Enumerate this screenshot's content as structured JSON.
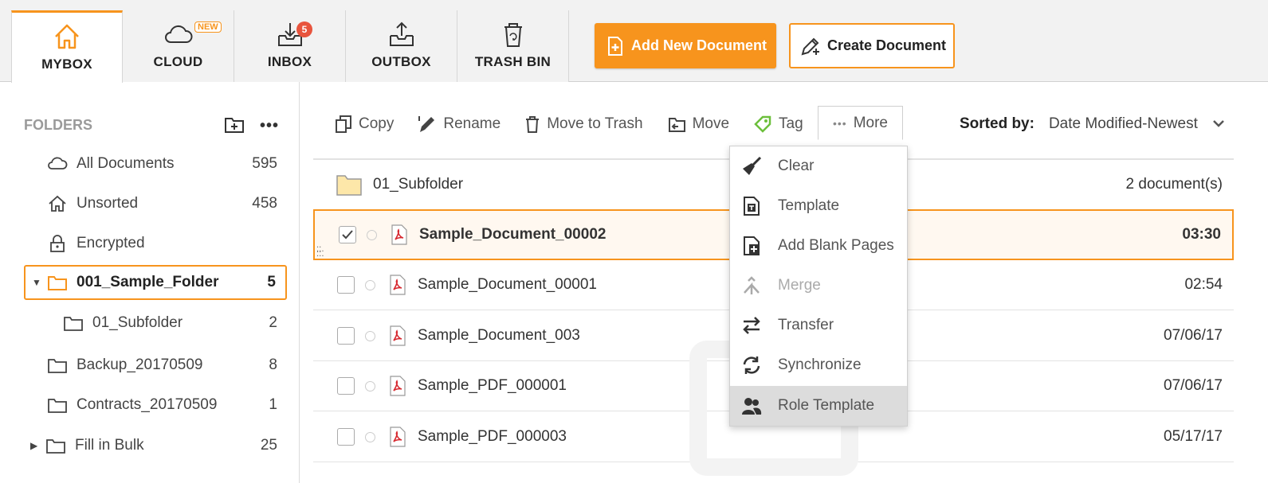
{
  "tabs": [
    {
      "label": "MYBOX",
      "icon": "home-icon"
    },
    {
      "label": "CLOUD",
      "icon": "cloud-icon",
      "badge": "NEW"
    },
    {
      "label": "INBOX",
      "icon": "inbox-icon",
      "badge": "5"
    },
    {
      "label": "OUTBOX",
      "icon": "outbox-icon"
    },
    {
      "label": "TRASH BIN",
      "icon": "trash-icon"
    }
  ],
  "header": {
    "add_new_label": "Add New Document",
    "create_label": "Create Document"
  },
  "sidebar": {
    "title": "FOLDERS",
    "more": "•••",
    "items": [
      {
        "label": "All Documents",
        "count": "595",
        "icon": "cloud-icon"
      },
      {
        "label": "Unsorted",
        "count": "458",
        "icon": "home-icon"
      },
      {
        "label": "Encrypted",
        "count": "",
        "icon": "lock-icon"
      },
      {
        "label": "001_Sample_Folder",
        "count": "5",
        "icon": "folder-icon",
        "expanded": "▼"
      },
      {
        "label": "01_Subfolder",
        "count": "2",
        "icon": "folder-icon"
      },
      {
        "label": "Backup_20170509",
        "count": "8",
        "icon": "folder-icon"
      },
      {
        "label": "Contracts_20170509",
        "count": "1",
        "icon": "folder-icon"
      },
      {
        "label": "Fill in Bulk",
        "count": "25",
        "icon": "folder-icon",
        "expanded": "▶"
      }
    ]
  },
  "toolbar": {
    "copy": "Copy",
    "rename": "Rename",
    "trash": "Move to Trash",
    "move": "Move",
    "tag": "Tag",
    "more": "More",
    "more_dots": "•••",
    "sorted_label": "Sorted by:",
    "sorted_value": "Date Modified-Newest"
  },
  "list": {
    "folder": {
      "name": "01_Subfolder",
      "info": "2 document(s)"
    },
    "rows": [
      {
        "name": "Sample_Document_00002",
        "date": "03:30"
      },
      {
        "name": "Sample_Document_00001",
        "date": "02:54"
      },
      {
        "name": "Sample_Document_003",
        "date": "07/06/17"
      },
      {
        "name": "Sample_PDF_000001",
        "date": "07/06/17"
      },
      {
        "name": "Sample_PDF_000003",
        "date": "05/17/17"
      }
    ]
  },
  "menu": {
    "items": [
      {
        "label": "Clear",
        "icon": "broom-icon"
      },
      {
        "label": "Template",
        "icon": "template-icon"
      },
      {
        "label": "Add Blank Pages",
        "icon": "add-page-icon"
      },
      {
        "label": "Merge",
        "icon": "merge-icon"
      },
      {
        "label": "Transfer",
        "icon": "transfer-icon"
      },
      {
        "label": "Synchronize",
        "icon": "sync-icon"
      },
      {
        "label": "Role Template",
        "icon": "users-icon"
      }
    ]
  },
  "colors": {
    "accent": "#f7941d",
    "badge": "#e8543d",
    "pdf_red": "#d7282f",
    "tag_green": "#6cbf3b"
  }
}
